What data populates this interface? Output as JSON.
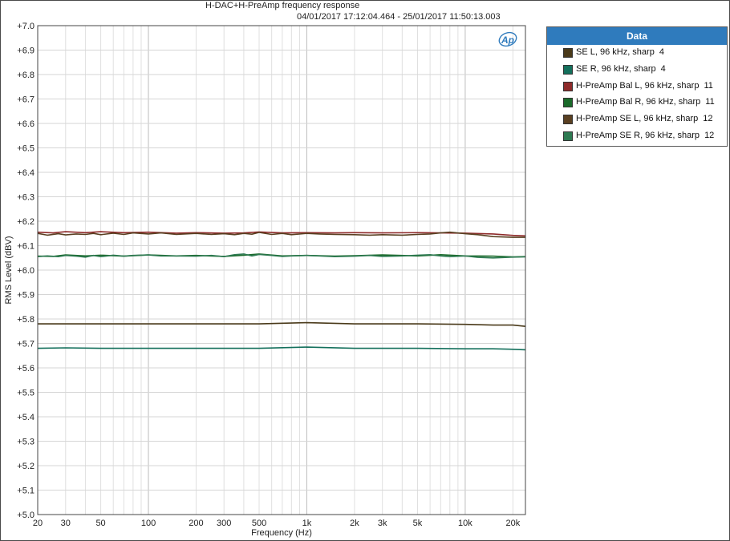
{
  "chart_data": {
    "type": "line",
    "title": "H-DAC+H-PreAmp frequency response",
    "subtitle": "04/01/2017 17:12:04.464 - 25/01/2017 11:50:13.003",
    "xlabel": "Frequency (Hz)",
    "ylabel": "RMS Level (dBV)",
    "xscale": "log",
    "xlim": [
      20,
      24000
    ],
    "ylim": [
      5.0,
      7.0
    ],
    "xticks": [
      {
        "v": 20,
        "label": "20"
      },
      {
        "v": 30,
        "label": "30"
      },
      {
        "v": 50,
        "label": "50"
      },
      {
        "v": 100,
        "label": "100"
      },
      {
        "v": 200,
        "label": "200"
      },
      {
        "v": 300,
        "label": "300"
      },
      {
        "v": 500,
        "label": "500"
      },
      {
        "v": 1000,
        "label": "1k"
      },
      {
        "v": 2000,
        "label": "2k"
      },
      {
        "v": 3000,
        "label": "3k"
      },
      {
        "v": 5000,
        "label": "5k"
      },
      {
        "v": 10000,
        "label": "10k"
      },
      {
        "v": 20000,
        "label": "20k"
      }
    ],
    "yticks": [
      "+5.0",
      "+5.1",
      "+5.2",
      "+5.3",
      "+5.4",
      "+5.5",
      "+5.6",
      "+5.7",
      "+5.8",
      "+5.9",
      "+6.0",
      "+6.1",
      "+6.2",
      "+6.3",
      "+6.4",
      "+6.5",
      "+6.6",
      "+6.7",
      "+6.8",
      "+6.9",
      "+7.0"
    ],
    "grid": true,
    "legend": {
      "title": "Data",
      "placement": "right"
    },
    "series": [
      {
        "name": "SE L, 96 kHz, sharp",
        "count": "4",
        "color": "#4a3a1a",
        "x": [
          20,
          30,
          50,
          100,
          200,
          500,
          1000,
          2000,
          5000,
          10000,
          15000,
          20000,
          24000
        ],
        "y": [
          5.78,
          5.78,
          5.78,
          5.78,
          5.78,
          5.78,
          5.785,
          5.78,
          5.78,
          5.778,
          5.775,
          5.775,
          5.77
        ]
      },
      {
        "name": "SE R, 96 kHz, sharp",
        "count": "4",
        "color": "#14705c",
        "x": [
          20,
          30,
          50,
          100,
          200,
          500,
          1000,
          2000,
          5000,
          10000,
          15000,
          20000,
          24000
        ],
        "y": [
          5.68,
          5.682,
          5.68,
          5.68,
          5.68,
          5.68,
          5.685,
          5.68,
          5.68,
          5.678,
          5.678,
          5.676,
          5.674
        ]
      },
      {
        "name": "H-PreAmp Bal L, 96 kHz, sharp",
        "count": "11",
        "color": "#8e2a2a",
        "x": [
          20,
          25,
          30,
          40,
          50,
          70,
          100,
          150,
          200,
          300,
          400,
          500,
          700,
          1000,
          1500,
          2000,
          3000,
          5000,
          7000,
          10000,
          15000,
          20000,
          24000
        ],
        "y": [
          6.155,
          6.152,
          6.157,
          6.153,
          6.157,
          6.153,
          6.155,
          6.151,
          6.153,
          6.151,
          6.152,
          6.156,
          6.152,
          6.153,
          6.152,
          6.153,
          6.152,
          6.153,
          6.152,
          6.151,
          6.148,
          6.142,
          6.14
        ]
      },
      {
        "name": "H-PreAmp Bal R, 96 kHz, sharp",
        "count": "11",
        "color": "#1a6a2a",
        "x": [
          20,
          25,
          30,
          40,
          50,
          70,
          100,
          150,
          200,
          300,
          400,
          500,
          700,
          1000,
          1500,
          2000,
          3000,
          5000,
          7000,
          10000,
          15000,
          20000,
          24000
        ],
        "y": [
          6.057,
          6.056,
          6.062,
          6.058,
          6.061,
          6.057,
          6.062,
          6.058,
          6.06,
          6.056,
          6.061,
          6.066,
          6.058,
          6.06,
          6.057,
          6.059,
          6.062,
          6.058,
          6.063,
          6.058,
          6.057,
          6.054,
          6.055
        ]
      },
      {
        "name": "H-PreAmp SE L, 96 kHz, sharp",
        "count": "12",
        "color": "#5a4022",
        "x": [
          20,
          23,
          27,
          30,
          35,
          40,
          45,
          50,
          60,
          70,
          80,
          100,
          120,
          150,
          200,
          250,
          300,
          350,
          400,
          450,
          500,
          600,
          700,
          800,
          1000,
          1200,
          1500,
          2000,
          2500,
          3000,
          4000,
          5000,
          6000,
          7000,
          8000,
          10000,
          12000,
          15000,
          20000,
          24000
        ],
        "y": [
          6.15,
          6.143,
          6.149,
          6.144,
          6.148,
          6.146,
          6.15,
          6.145,
          6.151,
          6.146,
          6.152,
          6.148,
          6.152,
          6.146,
          6.15,
          6.146,
          6.149,
          6.145,
          6.15,
          6.147,
          6.154,
          6.146,
          6.15,
          6.145,
          6.15,
          6.148,
          6.146,
          6.145,
          6.143,
          6.145,
          6.143,
          6.146,
          6.148,
          6.152,
          6.155,
          6.149,
          6.145,
          6.137,
          6.134,
          6.134
        ]
      },
      {
        "name": "H-PreAmp SE R, 96 kHz, sharp",
        "count": "12",
        "color": "#2e7a52",
        "x": [
          20,
          23,
          27,
          30,
          35,
          40,
          45,
          50,
          60,
          70,
          80,
          100,
          120,
          150,
          200,
          250,
          300,
          350,
          400,
          450,
          500,
          600,
          700,
          800,
          1000,
          1200,
          1500,
          2000,
          2500,
          3000,
          4000,
          5000,
          6000,
          7000,
          8000,
          10000,
          12000,
          15000,
          20000,
          24000
        ],
        "y": [
          6.055,
          6.058,
          6.055,
          6.06,
          6.057,
          6.053,
          6.06,
          6.055,
          6.061,
          6.057,
          6.06,
          6.062,
          6.058,
          6.058,
          6.057,
          6.06,
          6.055,
          6.063,
          6.066,
          6.058,
          6.064,
          6.06,
          6.056,
          6.058,
          6.06,
          6.058,
          6.055,
          6.057,
          6.06,
          6.056,
          6.058,
          6.061,
          6.063,
          6.058,
          6.055,
          6.058,
          6.052,
          6.05,
          6.053,
          6.054
        ]
      }
    ]
  }
}
